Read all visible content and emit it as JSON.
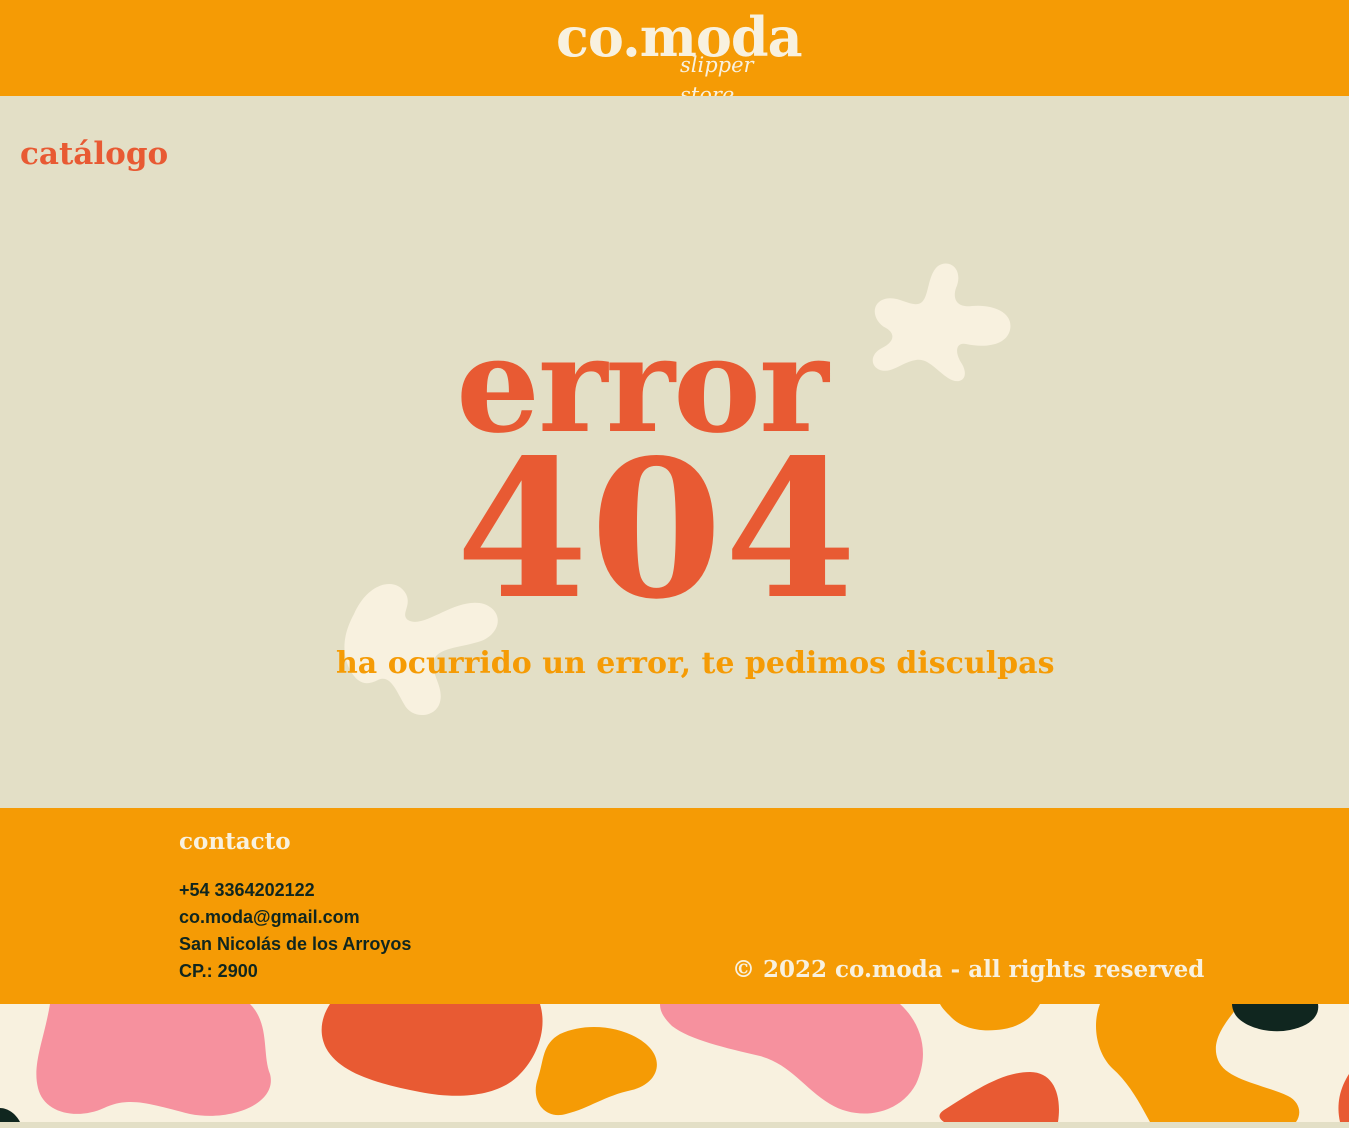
{
  "header": {
    "logo_main": "co.moda",
    "logo_sub": "slipper store"
  },
  "nav": {
    "catalog_label": "catálogo"
  },
  "error": {
    "word": "error",
    "code": "404",
    "message": "ha ocurrido un error, te pedimos disculpas"
  },
  "footer": {
    "contact_heading": "contacto",
    "phone": "+54 3364202122",
    "email": "co.moda@gmail.com",
    "city": "San Nicolás de los Arroyos",
    "postal_code": "CP.: 2900",
    "copyright": "© 2022 co.moda - all rights reserved"
  },
  "colors": {
    "orange": "#f59b05",
    "beige": "#e3dfc6",
    "red_orange": "#e85a33",
    "cream": "#f8f1df",
    "pink": "#f6919e",
    "dark_green": "#10261f"
  }
}
